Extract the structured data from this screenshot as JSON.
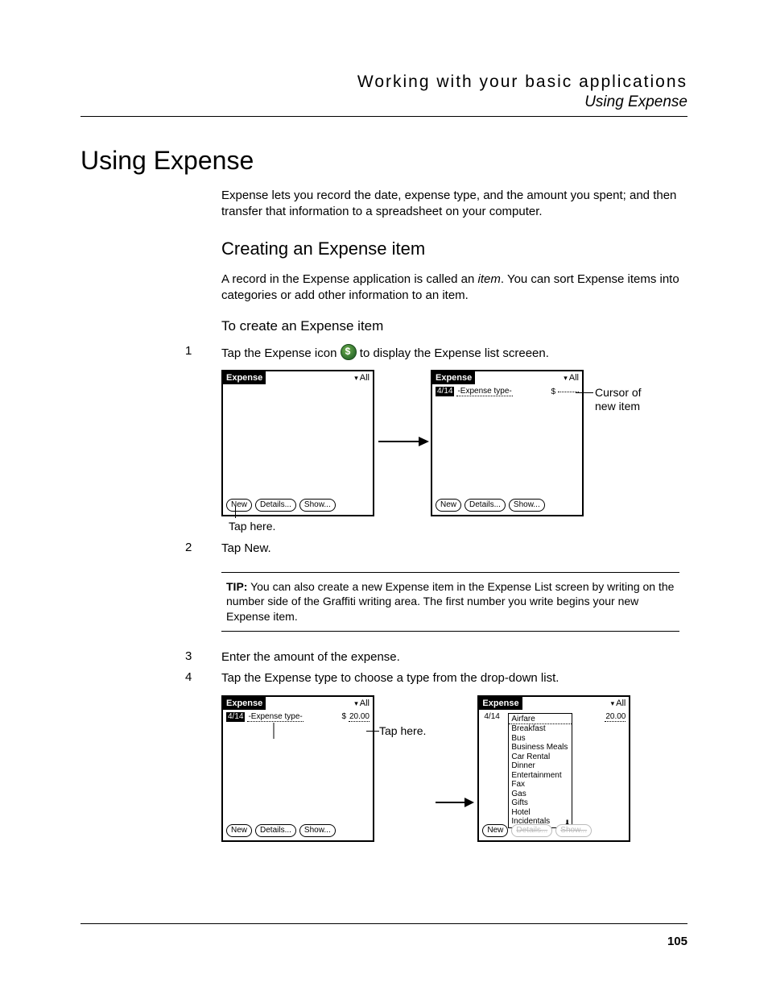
{
  "header": {
    "line1": "Working with your basic applications",
    "line2": "Using Expense"
  },
  "h1": "Using Expense",
  "intro": "Expense lets you record the date, expense type, and the amount you spent; and then transfer that information to a spreadsheet on your computer.",
  "h2": "Creating an Expense item",
  "h2_body_a": "A record in the Expense application is called an ",
  "h2_body_italic": "item",
  "h2_body_b": ". You can sort Expense items into categories or add other information to an item.",
  "h3": "To create an Expense item",
  "steps": {
    "s1_num": "1",
    "s1_a": "Tap the Expense icon  ",
    "s1_b": "  to display the Expense list screeen.",
    "s2_num": "2",
    "s2_text": "Tap New.",
    "s3_num": "3",
    "s3_text": "Enter the amount of the expense.",
    "s4_num": "4",
    "s4_text": "Tap the Expense type to choose a type from the drop-down list."
  },
  "palm": {
    "title": "Expense",
    "all": "All",
    "btn_new": "New",
    "btn_details": "Details...",
    "btn_show": "Show...",
    "item_date": "4/14",
    "item_type_placeholder": "-Expense type-",
    "item_type_selected": "Airfare",
    "currency": "$",
    "amount_entered": "20.00",
    "amount_blank": ""
  },
  "dropdown": [
    "Airfare",
    "Breakfast",
    "Bus",
    "Business Meals",
    "Car Rental",
    "Dinner",
    "Entertainment",
    "Fax",
    "Gas",
    "Gifts",
    "Hotel",
    "Incidentals"
  ],
  "callouts": {
    "tap_here": "Tap here.",
    "cursor_new_item_l1": "Cursor of",
    "cursor_new_item_l2": "new item"
  },
  "tip": {
    "label": "TIP:",
    "text": "  You can also create a new Expense item in the Expense List screen by writing on the number side of the Graffiti writing area. The first number you write begins your new Expense item."
  },
  "page_number": "105"
}
